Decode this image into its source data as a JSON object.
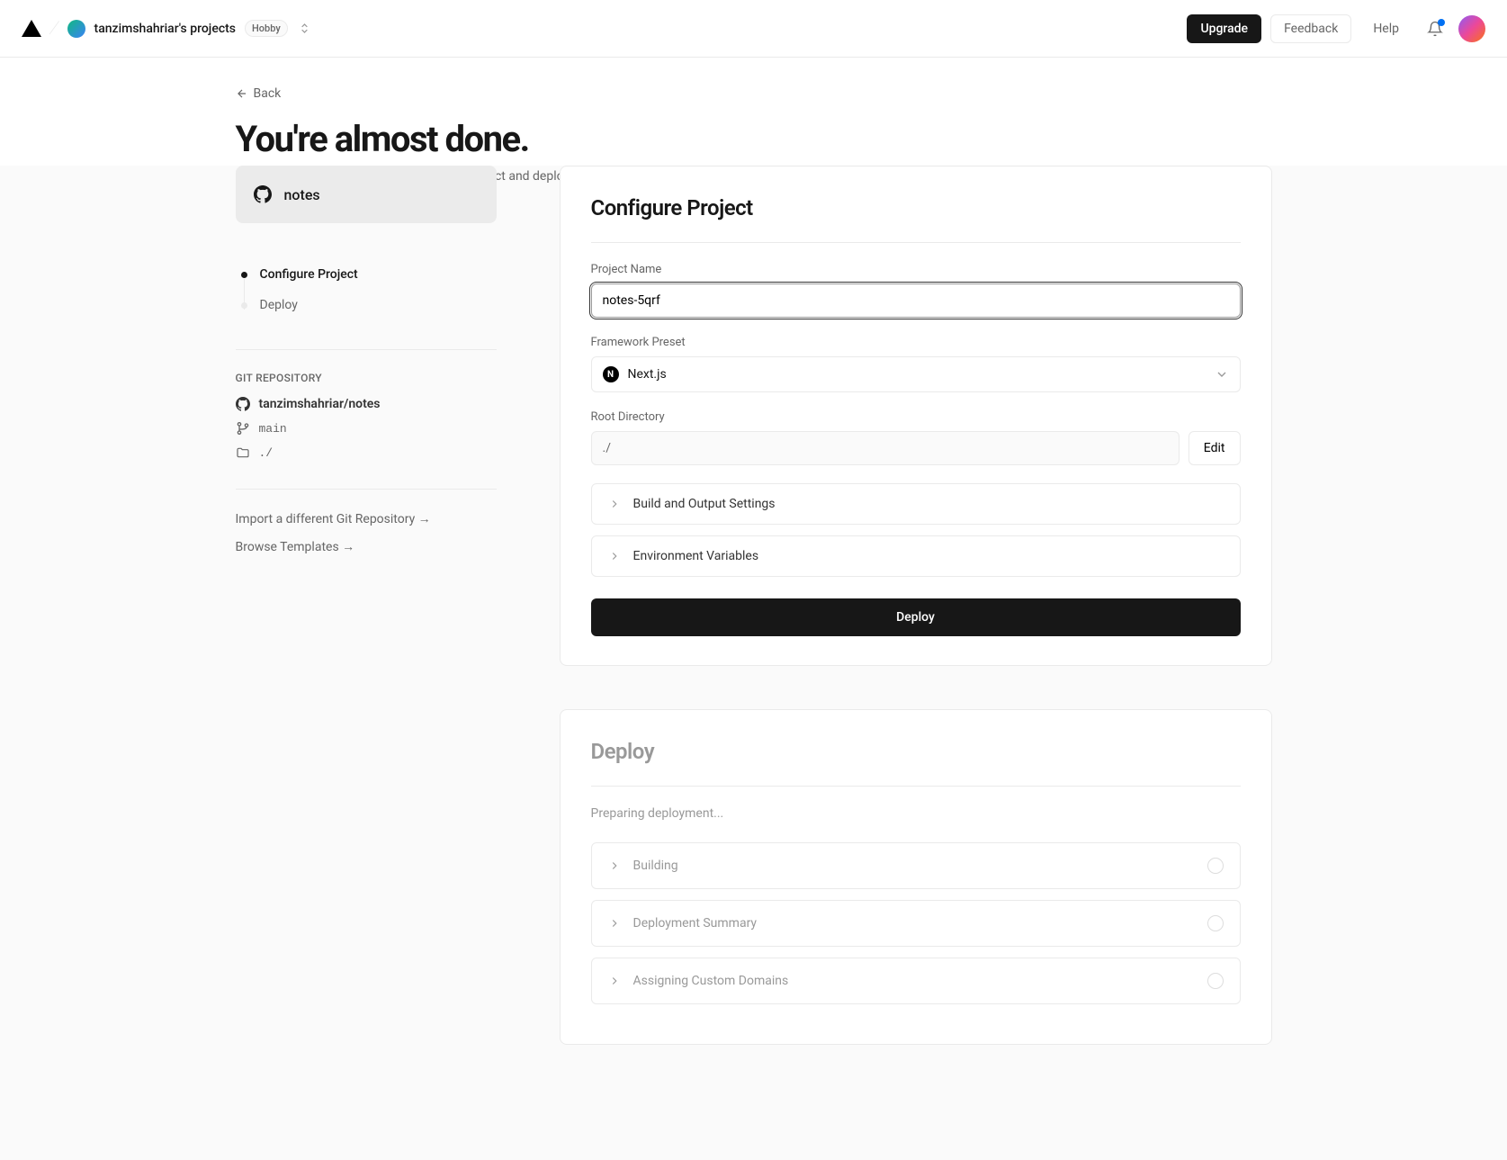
{
  "header": {
    "team_name": "tanzimshahriar's projects",
    "plan_badge": "Hobby",
    "upgrade": "Upgrade",
    "feedback": "Feedback",
    "help": "Help"
  },
  "page": {
    "back": "Back",
    "title": "You're almost done.",
    "subtitle": "Please follow the steps to configure your Project and deploy it."
  },
  "sidebar": {
    "repo_name": "notes",
    "steps": [
      {
        "label": "Configure Project",
        "active": true
      },
      {
        "label": "Deploy",
        "active": false
      }
    ],
    "git_section_title": "GIT REPOSITORY",
    "repo_path": "tanzimshahriar/notes",
    "branch": "main",
    "directory": "./",
    "import_link": "Import a different Git Repository →",
    "browse_link": "Browse Templates →"
  },
  "configure": {
    "title": "Configure Project",
    "project_name_label": "Project Name",
    "project_name_value": "notes-5qrf",
    "framework_label": "Framework Preset",
    "framework_value": "Next.js",
    "root_dir_label": "Root Directory",
    "root_dir_value": "./",
    "edit_btn": "Edit",
    "build_settings": "Build and Output Settings",
    "env_vars": "Environment Variables",
    "deploy_btn": "Deploy"
  },
  "deploy": {
    "title": "Deploy",
    "status": "Preparing deployment...",
    "steps": [
      "Building",
      "Deployment Summary",
      "Assigning Custom Domains"
    ]
  }
}
